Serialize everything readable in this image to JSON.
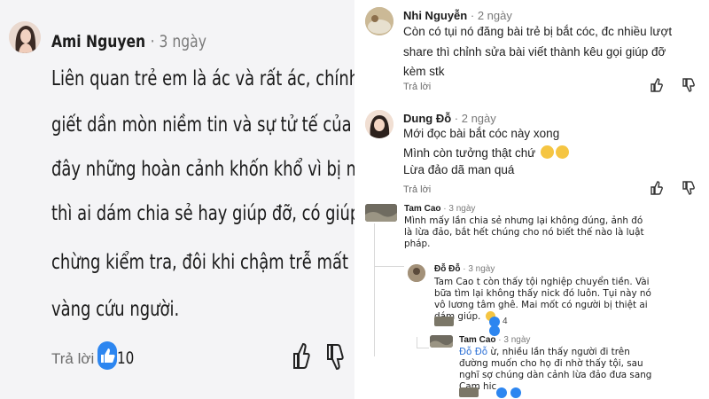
{
  "left": {
    "author": "Ami Nguyen",
    "time": "3 ngày",
    "lines": [
      "Liên quan trẻ em là ác và rất ác, chính chúng đã",
      "giết dần mòn niềm tin và sự tử tế của con người. Giờ",
      "đây những hoàn cảnh khốn khổ vì bị mất con thật",
      "thì ai dám chia sẻ hay giúp đỡ, có giúp cũng rất dè",
      "chừng kiểm tra, đôi khi chậm trễ mất luôn thời gian",
      "vàng cứu người."
    ],
    "reply_label": "Trả lời",
    "like_count": "10"
  },
  "right": {
    "comments": [
      {
        "author": "Nhi Nguyễn",
        "time": "2 ngày",
        "lines": [
          "Còn có tụi nó đăng bài trẻ bị bắt cóc, đc nhiều lượt",
          "share thì chỉnh sửa bài viết thành kêu gọi giúp đỡ",
          "kèm stk"
        ],
        "reply_label": "Trả lời"
      },
      {
        "author": "Dung Đỗ",
        "time": "2 ngày",
        "lines": [
          "Mới đọc bài bắt cóc này xong",
          "Mình còn tưởng thật chứ",
          "Lừa đảo dã man quá"
        ],
        "reply_label": "Trả lời"
      }
    ],
    "tam1": {
      "author": "Tam Cao",
      "time": "3 ngày",
      "lines": [
        "Mình mấy lần chia sẻ nhưng lại không đúng, ảnh đó",
        "là lừa đảo, bắt hết chúng cho nó biết thế nào là luật",
        "pháp."
      ]
    },
    "do": {
      "author": "Đỗ Đỗ",
      "time": "3 ngày",
      "lines": [
        "Tam Cao t còn thấy tội nghiệp chuyển tiền. Vài",
        "bữa tìm lại không thấy nick đó luôn. Tụi này nó",
        "vô lương tâm ghê. Mai mốt có người bị thiệt ai",
        "dám giúp."
      ],
      "like_count": "4"
    },
    "tam2": {
      "author": "Tam Cao",
      "time": "3 ngày",
      "mention": "Đỗ Đỗ",
      "lines": [
        " ừ, nhiều lần thấy người đi trên",
        "đường muốn cho họ đi nhờ thấy tội, sau",
        "nghĩ sợ chúng dàn cảnh lừa đảo đưa sang",
        "Cam hic"
      ],
      "like_count": "1"
    }
  }
}
